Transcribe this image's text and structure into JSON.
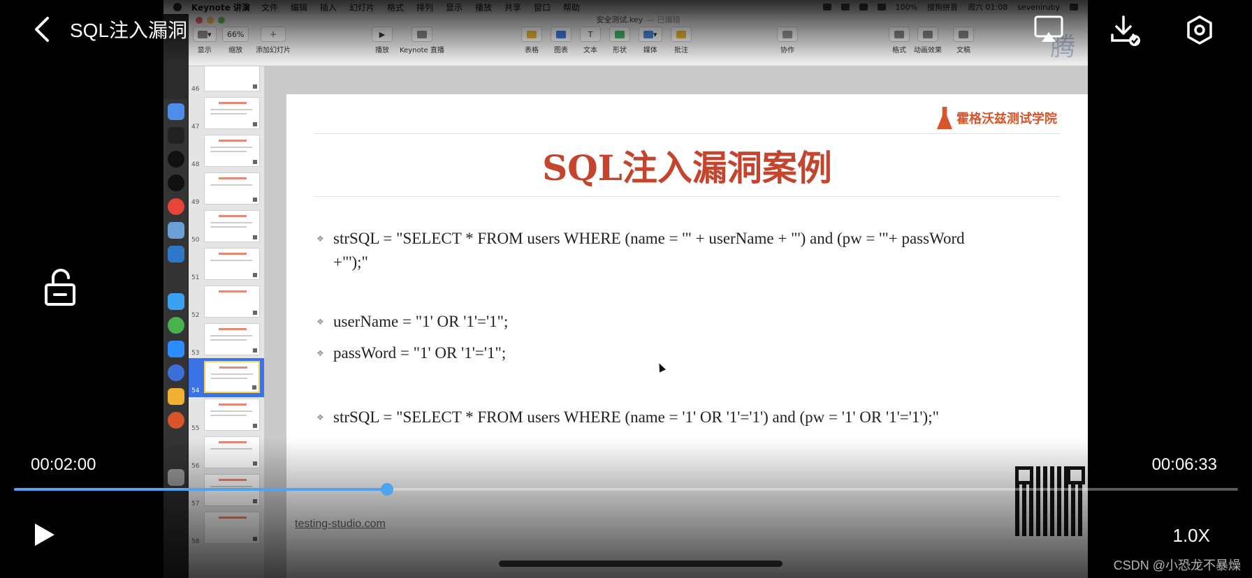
{
  "player": {
    "title": "SQL注入漏洞",
    "time_current": "00:02:00",
    "time_total": "00:06:33",
    "progress": 0.305,
    "speed": "1.0X",
    "watermark_corner": "CSDN @小恐龙不暴燥",
    "accent_color": "#4fa4ef"
  },
  "mac_menubar": {
    "app": "Keynote 讲演",
    "menus": [
      "文件",
      "编辑",
      "插入",
      "幻灯片",
      "格式",
      "排列",
      "显示",
      "播放",
      "共享",
      "窗口",
      "帮助"
    ],
    "battery": "100%",
    "input_method": "搜狗拼音",
    "clock": "周六 01:08",
    "user": "seveniruby"
  },
  "keynote": {
    "window_title": "安全测试.key",
    "edited_label": "— 已编辑",
    "toolbar": {
      "view": "显示",
      "zoom_value": "66%",
      "zoom": "缩放",
      "add_slide": "添加幻灯片",
      "play": "播放",
      "live": "Keynote 直播",
      "table": "表格",
      "chart": "图表",
      "text": "文本",
      "shape": "形状",
      "media": "媒体",
      "comment": "批注",
      "collaborate": "协作",
      "format": "格式",
      "animate": "动画效果",
      "document": "文稿"
    },
    "watermark": "腾讯课堂",
    "thumbnails": [
      "46",
      "47",
      "48",
      "49",
      "50",
      "51",
      "52",
      "53",
      "54",
      "55",
      "56",
      "57",
      "58"
    ],
    "selected_slide": "54"
  },
  "slide": {
    "brand": "霍格沃兹测试学院",
    "title": "SQL注入漏洞案例",
    "bullet1_line1": "strSQL = \"SELECT * FROM users WHERE (name = '\" + userName + \"') and (pw = '\"+ passWord",
    "bullet1_line2": "+\"');\"",
    "bullet2": "userName = \"1' OR '1'='1\";",
    "bullet3": "passWord = \"1' OR '1'='1\";",
    "bullet4": "strSQL = \"SELECT * FROM users WHERE (name = '1' OR '1'='1') and (pw = '1' OR '1'='1');\"",
    "footer": "testing-studio.com",
    "title_color": "#c4442e"
  }
}
